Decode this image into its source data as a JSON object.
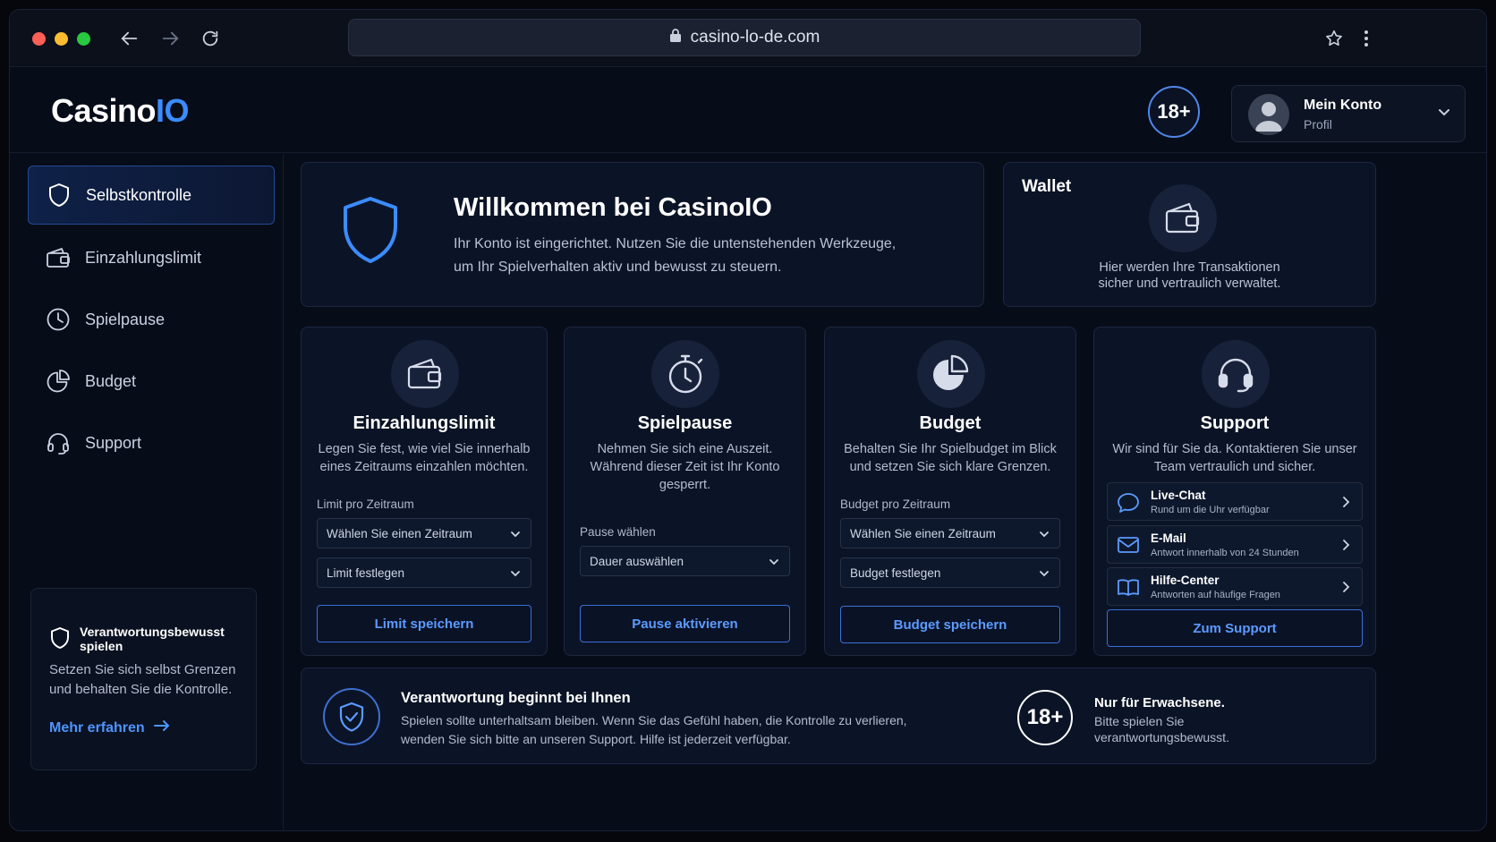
{
  "browser": {
    "url": "casino-lo-de.com"
  },
  "header": {
    "logo_main": "Casino",
    "logo_accent": "IO",
    "age_badge": "18+",
    "account_title": "Mein Konto",
    "account_sub": "Profil"
  },
  "sidebar": {
    "items": [
      {
        "label": "Selbstkontrolle",
        "icon": "shield-icon"
      },
      {
        "label": "Einzahlungslimit",
        "icon": "wallet-icon"
      },
      {
        "label": "Spielpause",
        "icon": "clock-icon"
      },
      {
        "label": "Budget",
        "icon": "pie-chart-icon"
      },
      {
        "label": "Support",
        "icon": "headset-icon"
      }
    ],
    "responsible": {
      "title": "Verantwortungsbewusst spielen",
      "text": "Setzen Sie sich selbst Grenzen und behalten Sie die Kontrolle.",
      "link": "Mehr erfahren"
    }
  },
  "welcome": {
    "title": "Willkommen bei CasinoIO",
    "text": "Ihr Konto ist eingerichtet. Nutzen Sie die untenstehenden Werkzeuge, um Ihr Spielverhalten aktiv und bewusst zu steuern."
  },
  "wallet": {
    "title": "Wallet",
    "text_line1": "Hier werden Ihre Transaktionen",
    "text_line2": "sicher und vertraulich verwaltet."
  },
  "deposit": {
    "title": "Einzahlungslimit",
    "desc": "Legen Sie fest, wie viel Sie innerhalb eines Zeitraums einzahlen möchten.",
    "label": "Limit pro Zeitraum",
    "select1": "Wählen Sie einen Zeitraum",
    "select2": "Limit festlegen",
    "button": "Limit speichern"
  },
  "pause": {
    "title": "Spielpause",
    "desc": "Nehmen Sie sich eine Auszeit. Während dieser Zeit ist Ihr Konto gesperrt.",
    "label": "Pause wählen",
    "select1": "Dauer auswählen",
    "button": "Pause aktivieren"
  },
  "budget": {
    "title": "Budget",
    "desc": "Behalten Sie Ihr Spielbudget im Blick und setzen Sie sich klare Grenzen.",
    "label": "Budget pro Zeitraum",
    "select1": "Wählen Sie einen Zeitraum",
    "select2": "Budget festlegen",
    "button": "Budget speichern"
  },
  "support": {
    "title": "Support",
    "desc": "Wir sind für Sie da. Kontaktieren Sie unser Team vertraulich und sicher.",
    "rows": [
      {
        "title": "Live-Chat",
        "sub": "Rund um die Uhr verfügbar"
      },
      {
        "title": "E-Mail",
        "sub": "Antwort innerhalb von 24 Stunden"
      },
      {
        "title": "Hilfe-Center",
        "sub": "Antworten auf häufige Fragen"
      }
    ],
    "button": "Zum Support"
  },
  "footer": {
    "title": "Verantwortung beginnt bei Ihnen",
    "text": "Spielen sollte unterhaltsam bleiben. Wenn Sie das Gefühl haben, die Kontrolle zu verlieren, wenden Sie sich bitte an unseren Support. Hilfe ist jederzeit verfügbar.",
    "age": "18+",
    "adult_title": "Nur für Erwachsene.",
    "adult_text": "Bitte spielen Sie verantwortungsbewusst."
  }
}
